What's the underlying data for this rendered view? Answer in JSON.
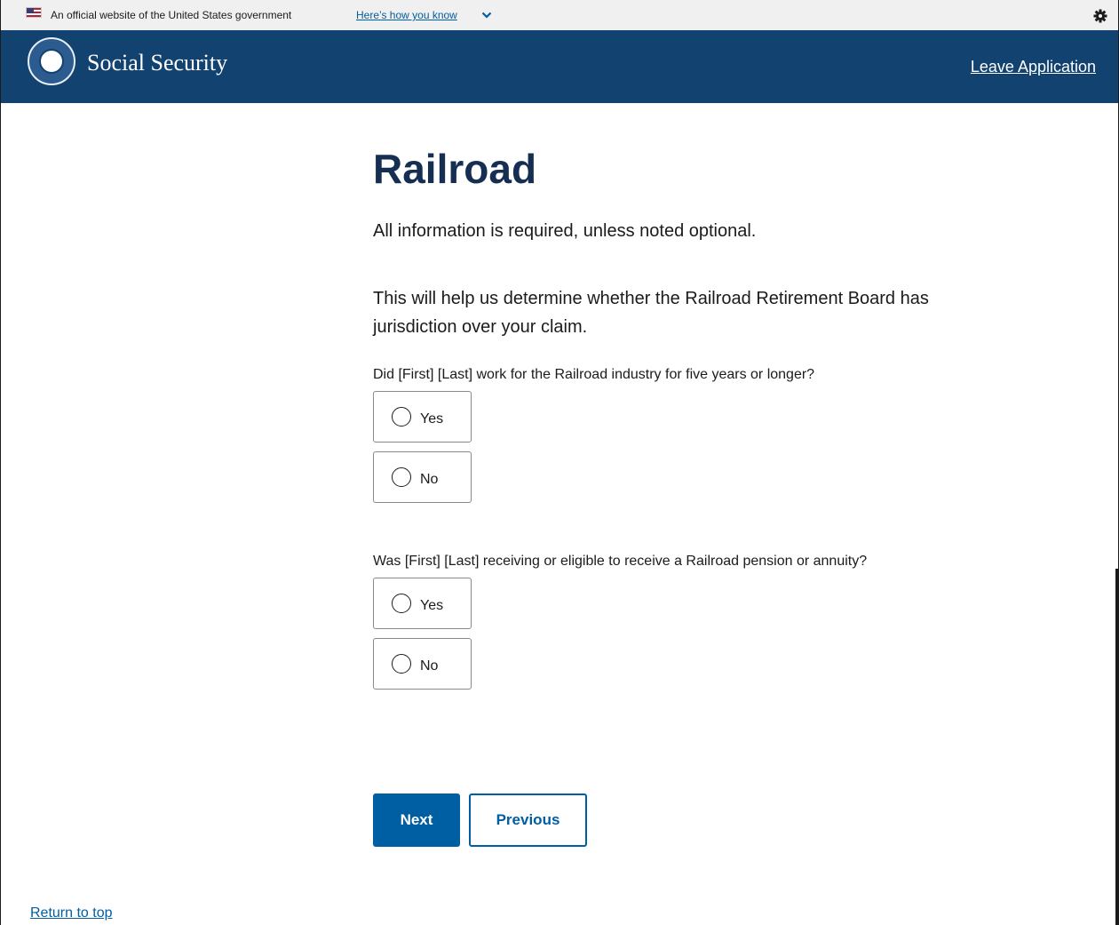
{
  "gov_banner": {
    "text": "An official website of the United States government",
    "link": "Here’s how you know"
  },
  "header": {
    "brand": "Social Security",
    "leave_link": "Leave Application"
  },
  "main": {
    "title": "Railroad",
    "required_note": "All information is required, unless noted optional.",
    "info_text": "This will help us determine whether the Railroad Retirement Board has jurisdiction over your claim.",
    "questions": [
      {
        "text": "Did [First] [Last] work for the Railroad industry for five years or longer?",
        "options": [
          "Yes",
          "No"
        ],
        "selected": null
      },
      {
        "text": "Was [First] [Last] receiving or eligible to receive a Railroad pension or annuity?",
        "options": [
          "Yes",
          "No"
        ],
        "selected": null
      }
    ]
  },
  "buttons": {
    "next": "Next",
    "previous": "Previous"
  },
  "footer": {
    "return_to_top": "Return to top"
  },
  "colors": {
    "header_bg": "#12426f",
    "primary": "#005ea2",
    "title": "#162e51",
    "banner_bg": "#f0f0f0"
  }
}
